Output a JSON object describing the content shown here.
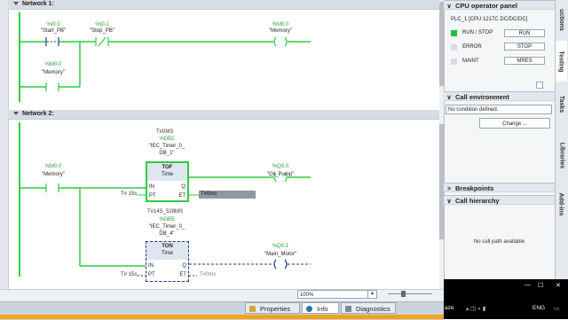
{
  "network1": {
    "header": "Network 1:",
    "start": {
      "addr": "%I0.0",
      "name": "\"Start_PB\""
    },
    "stop": {
      "addr": "%I0.1",
      "name": "\"Stop_PB\""
    },
    "coil": {
      "addr": "%M0.0",
      "name": "\"Memory\""
    },
    "hold": {
      "addr": "%M0.0",
      "name": "\"Memory\""
    }
  },
  "network2": {
    "header": "Network 2:",
    "memory": {
      "addr": "%M0.0",
      "name": "\"Memory\""
    },
    "tof": {
      "top_value": "T#0MS",
      "db": "%DB2",
      "instance_1": "\"IEC_Timer_0_",
      "instance_2": "DB_1\"",
      "title": "TOF",
      "subtitle": "Time",
      "pin_in": "IN",
      "pin_q": "Q",
      "pin_pt": "PT",
      "pin_et": "ET",
      "pt_value": "T# 15s",
      "et_value": "T#0ms"
    },
    "oil_pump": {
      "addr": "%Q0.0",
      "name": "\"Oil_Pump\""
    },
    "ton": {
      "top_value": "T#14S_528MS",
      "db": "%DB5",
      "instance_1": "\"IEC_Timer_0_",
      "instance_2": "DB_4\"",
      "title": "TON",
      "subtitle": "Time",
      "pin_in": "IN",
      "pin_q": "Q",
      "pin_pt": "PT",
      "pin_et": "ET",
      "pt_value": "T# 15s",
      "et_value": "T#0ms"
    },
    "main_motor": {
      "addr": "%Q0.1",
      "name": "\"Main_Motor\""
    }
  },
  "bottom": {
    "zoom": "100%",
    "tab_properties": "Properties",
    "tab_info": "Info",
    "tab_diagnostics": "Diagnostics"
  },
  "right_panel": {
    "cpu_panel_title": "CPU operator panel",
    "cpu_name": "PLC_1 [CPU 1217C DC/DC/DC]",
    "leds": [
      {
        "label": "RUN / STOP",
        "color": "#22c33a"
      },
      {
        "label": "ERROR",
        "color": "#d9dcdf"
      },
      {
        "label": "MAINT",
        "color": "#d9dcdf"
      }
    ],
    "btn_run": "RUN",
    "btn_stop": "STOP",
    "btn_mres": "MRES",
    "call_env_title": "Call environment",
    "condition": "No condition defined.",
    "change": "Change ...",
    "breakpoints_title": "Breakpoints",
    "call_hierarchy_title": "Call hierarchy",
    "no_call_path": "No call path available"
  },
  "side_tabs": {
    "instructions": "uctions",
    "testing": "Testing",
    "tasks": "Tasks",
    "libraries": "Libraries",
    "addins": "Add-ins"
  },
  "taskbar": {
    "min": "—",
    "max": "☐",
    "close": "✕",
    "app_fragment": "aze",
    "lang": "ENG"
  },
  "colors": {
    "energized": "#2ecc40",
    "address": "#2a9a3a",
    "accent_orange": "#f3a21c"
  }
}
